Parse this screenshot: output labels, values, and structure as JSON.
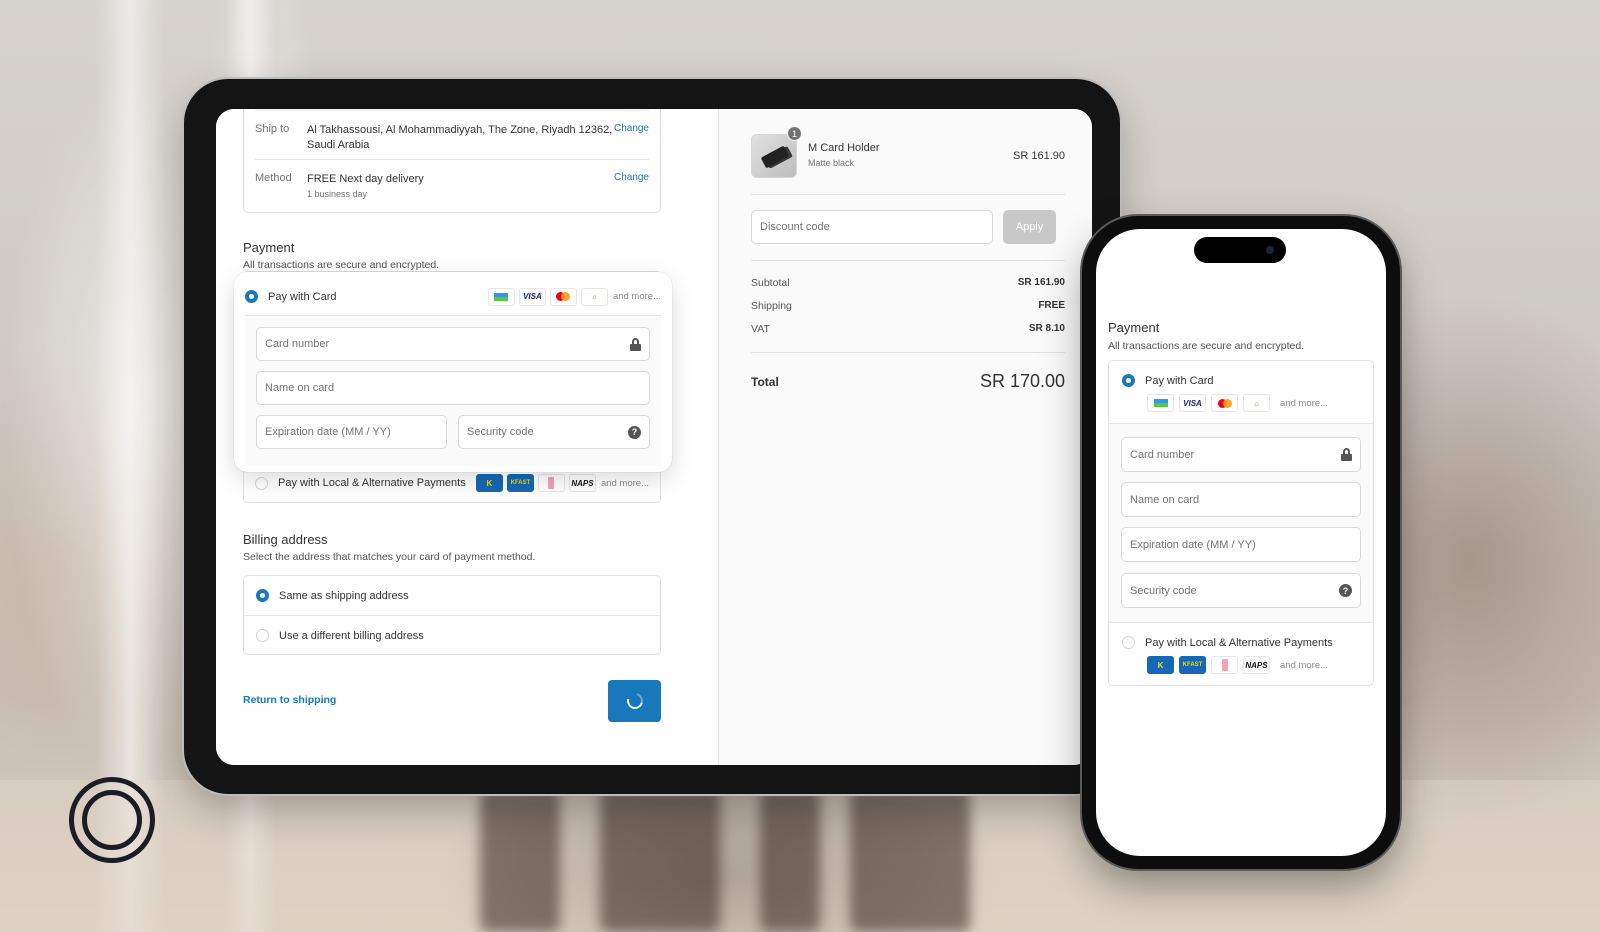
{
  "tablet": {
    "shipping": {
      "ship_to_label": "Ship to",
      "ship_to_value_line1": "Al Takhassousi, Al Mohammadiyyah, The Zone, Riyadh 12362,",
      "ship_to_value_line2": "Saudi Arabia",
      "method_label": "Method",
      "method_value": "FREE Next day delivery",
      "method_sub": "1 business day",
      "change_label": "Change"
    },
    "payment": {
      "title": "Payment",
      "subtitle": "All transactions are secure and encrypted.",
      "card_option_label": "Pay with Card",
      "card_brands": [
        "mada",
        "VISA",
        "mastercard",
        "other"
      ],
      "more_label": "and more...",
      "card_number_placeholder": "Card number",
      "name_on_card_placeholder": "Name on card",
      "expiration_placeholder": "Expiration date (MM / YY)",
      "security_code_placeholder": "Security code",
      "alt_option_label": "Pay with Local & Alternative Payments",
      "alt_brands": [
        "K-NET",
        "KFAST",
        "other",
        "NAPS"
      ]
    },
    "billing": {
      "title": "Billing address",
      "subtitle": "Select the address that matches your card of payment method.",
      "same_label": "Same as shipping address",
      "different_label": "Use a different billing address"
    },
    "return_link": "Return to shipping",
    "summary": {
      "product_name": "M Card Holder",
      "product_variant": "Matte black",
      "product_qty": "1",
      "product_price": "SR 161.90",
      "discount_placeholder": "Discount code",
      "apply_label": "Apply",
      "subtotal_label": "Subtotal",
      "subtotal_value": "SR 161.90",
      "shipping_label": "Shipping",
      "shipping_value": "FREE",
      "vat_label": "VAT",
      "vat_value": "SR 8.10",
      "total_label": "Total",
      "total_value": "SR 170.00"
    }
  },
  "phone": {
    "title": "Payment",
    "subtitle": "All transactions are secure and encrypted.",
    "card_option_label": "Pay with Card",
    "more_label": "and more...",
    "card_number_placeholder": "Card number",
    "name_on_card_placeholder": "Name on card",
    "expiration_placeholder": "Expiration date (MM / YY)",
    "security_code_placeholder": "Security code",
    "alt_option_label": "Pay with Local & Alternative Payments"
  },
  "brand_text": {
    "visa": "VISA",
    "naps": "NAPS",
    "help": "?"
  },
  "colors": {
    "accent": "#1878b9",
    "apply_disabled": "#c8c8c8"
  }
}
